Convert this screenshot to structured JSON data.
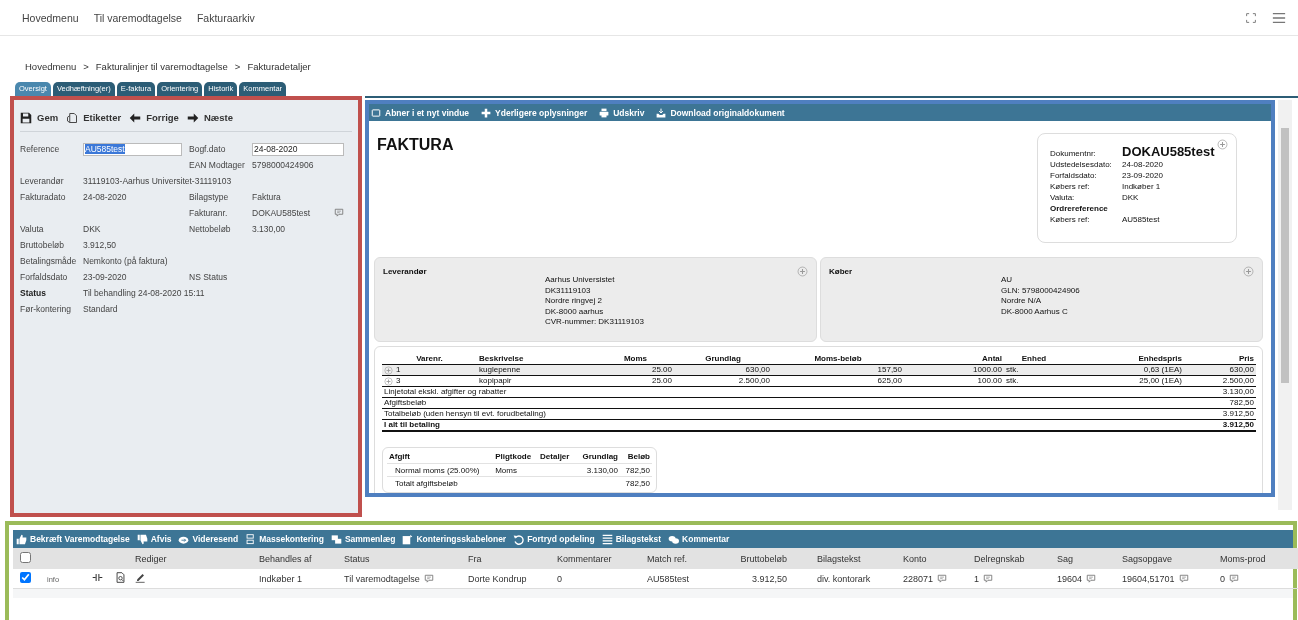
{
  "top_nav": {
    "items": [
      "Hovedmenu",
      "Til varemodtagelse",
      "Fakturaarkiv"
    ]
  },
  "breadcrumb": {
    "items": [
      "Hovedmenu",
      "Fakturalinjer til varemodtagelse",
      "Fakturadetaljer"
    ],
    "separator": ">"
  },
  "tabs": [
    {
      "label": "Oversigt",
      "selected": true
    },
    {
      "label": "Vedhæftning(er)",
      "selected": false
    },
    {
      "label": "E-faktura",
      "selected": false
    },
    {
      "label": "Orientering",
      "selected": false
    },
    {
      "label": "Historik",
      "selected": false
    },
    {
      "label": "Kommentar",
      "selected": false
    }
  ],
  "details": {
    "toolbar": [
      {
        "label": "Gem",
        "kind": "save"
      },
      {
        "label": "Etiketter",
        "kind": "tag"
      },
      {
        "label": "Forrige",
        "kind": "prev"
      },
      {
        "label": "Næste",
        "kind": "next"
      }
    ],
    "rows": [
      {
        "left": {
          "label": "Reference",
          "value": "AU585test",
          "kind": "input",
          "highlighted": true
        },
        "right": {
          "label": "Bogf.dato",
          "value": "24-08-2020",
          "kind": "input",
          "highlighted": false
        }
      },
      {
        "right": {
          "label": "EAN Modtager",
          "value": "5798000424906"
        }
      },
      {
        "left": {
          "label": "Leverandør",
          "value": "31119103-Aarhus Universitet-31119103"
        }
      },
      {
        "left": {
          "label": "Fakturadato",
          "value": "24-08-2020"
        },
        "right": {
          "label": "Bilagstype",
          "value": "Faktura"
        }
      },
      {
        "right": {
          "label": "Fakturanr.",
          "value": "DOKAU585test",
          "comment": true
        }
      },
      {
        "left": {
          "label": "Valuta",
          "value": "DKK"
        },
        "right": {
          "label": "Nettobeløb",
          "value": "3.130,00"
        }
      },
      {
        "left": {
          "label": "Bruttobeløb",
          "value": "3.912,50"
        }
      },
      {
        "left": {
          "label": "Betalingsmåde",
          "value": "Nemkonto (på faktura)"
        }
      },
      {
        "left": {
          "label": "Forfaldsdato",
          "value": "23-09-2020"
        },
        "right": {
          "label": "NS Status"
        }
      },
      {
        "left": {
          "label": "Status",
          "value": "Til behandling 24-08-2020 15:11",
          "bold": true
        }
      },
      {
        "left": {
          "label": "Før-kontering",
          "value": "Standard"
        }
      }
    ]
  },
  "document": {
    "toolbar": [
      {
        "label": "Abner i et nyt vindue",
        "kind": "window"
      },
      {
        "label": "Yderligere oplysninger",
        "kind": "plus"
      },
      {
        "label": "Udskriv",
        "kind": "print"
      },
      {
        "label": "Download originaldokument",
        "kind": "download"
      }
    ],
    "title": "FAKTURA",
    "info": [
      {
        "label": "Dokumentnr:",
        "value": "DOKAU585test",
        "kind": "main"
      },
      {
        "label": "Udstedelsesdato:",
        "value": "24-08-2020",
        "kind": "pair"
      },
      {
        "label": "Forfaldsdato:",
        "value": "23-09-2020",
        "kind": "pair"
      },
      {
        "label": "Købers ref:",
        "value": "Indkøber 1",
        "kind": "pair"
      },
      {
        "label": "Valuta:",
        "value": "DKK",
        "kind": "pair"
      },
      {
        "label": "Ordrereference",
        "kind": "heading"
      },
      {
        "label": "Købers ref:",
        "value": "AU585test",
        "kind": "pair"
      }
    ],
    "parties": [
      {
        "title": "Leverandør",
        "lines": [
          "Aarhus Universistet",
          "DK31119103",
          "Nordre ringvej 2",
          "DK-8000 aarhus",
          "CVR-nummer: DK31119103"
        ]
      },
      {
        "title": "Køber",
        "lines": [
          "AU",
          "GLN: 5798000424906",
          "Nordre N/A",
          "DK-8000 Aarhus C"
        ]
      }
    ],
    "lines": {
      "columns": [
        "Varenr.",
        "Beskrivelse",
        "Moms",
        "Grundlag",
        "Moms-beløb",
        "Antal",
        "Enhed",
        "Enhedspris",
        "Pris"
      ],
      "rows": [
        {
          "highlighted": true,
          "cells": [
            "1",
            "kuglepenne",
            "25.00",
            "630,00",
            "157,50",
            "1000.00",
            "stk.",
            "0,63 (1EA)",
            "630,00"
          ]
        },
        {
          "highlighted": false,
          "cells": [
            "3",
            "kopipapir",
            "25.00",
            "2.500,00",
            "625,00",
            "100.00",
            "stk.",
            "25,00 (1EA)",
            "2.500,00"
          ]
        }
      ],
      "totals": [
        {
          "label": "Linjetotal ekskl. afgifter og rabatter",
          "value": "3.130,00",
          "bold": false
        },
        {
          "label": "Afgiftsbeløb",
          "value": "782,50",
          "bold": false
        },
        {
          "label": "Totalbeløb (uden hensyn til evt. forudbetaling)",
          "value": "3.912,50",
          "bold": false
        },
        {
          "label": "I alt til betaling",
          "value": "3.912,50",
          "bold": true
        }
      ]
    },
    "tax": {
      "columns": [
        "Afgift",
        "Pligtkode",
        "Detaljer",
        "Grundlag",
        "Beløb"
      ],
      "rows": [
        {
          "afgift": "Normal moms (25.00%)",
          "pligtkode": "Moms",
          "grundlag": "3.130,00",
          "beloeb": "782,50"
        },
        {
          "afgift": "Totalt afgiftsbeløb",
          "beloeb": "782,50"
        }
      ]
    }
  },
  "grid": {
    "toolbar": [
      {
        "label": "Bekræft Varemodtagelse",
        "kind": "thumbs-up"
      },
      {
        "label": "Afvis",
        "kind": "thumbs-down"
      },
      {
        "label": "Videresend",
        "kind": "forward"
      },
      {
        "label": "Massekontering",
        "kind": "list"
      },
      {
        "label": "Sammenlæg",
        "kind": "stack"
      },
      {
        "label": "Konteringsskabeloner",
        "kind": "template"
      },
      {
        "label": "Fortryd opdeling",
        "kind": "undo"
      },
      {
        "label": "Bilagstekst",
        "kind": "lines"
      },
      {
        "label": "Kommentar",
        "kind": "chat"
      }
    ],
    "header_checked": false,
    "columns": [
      "Rediger",
      "Behandles af",
      "Status",
      "Fra",
      "Kommentarer",
      "Match ref.",
      "Bruttobeløb",
      "Bilagstekst",
      "Konto",
      "Delregnskab",
      "Sag",
      "Sagsopgave",
      "Moms-prod"
    ],
    "rows": [
      {
        "checked": true,
        "info": "info",
        "cells": [
          {
            "kind": "edit"
          },
          {
            "kind": "text",
            "text": "Indkøber 1",
            "comment": false
          },
          {
            "kind": "text",
            "text": "Til varemodtagelse",
            "comment": true
          },
          {
            "kind": "text",
            "text": "Dorte Kondrup",
            "comment": false
          },
          {
            "kind": "text",
            "text": "0",
            "comment": false
          },
          {
            "kind": "text",
            "text": "AU585test",
            "comment": false
          },
          {
            "kind": "text",
            "text": "3.912,50",
            "comment": false
          },
          {
            "kind": "text",
            "text": "div. kontorark",
            "comment": false
          },
          {
            "kind": "text",
            "text": "228071",
            "comment": true
          },
          {
            "kind": "text",
            "text": "1",
            "comment": true
          },
          {
            "kind": "text",
            "text": "19604",
            "comment": true
          },
          {
            "kind": "text",
            "text": "19604,51701",
            "comment": true
          },
          {
            "kind": "text",
            "text": "0",
            "comment": true
          }
        ]
      }
    ]
  }
}
